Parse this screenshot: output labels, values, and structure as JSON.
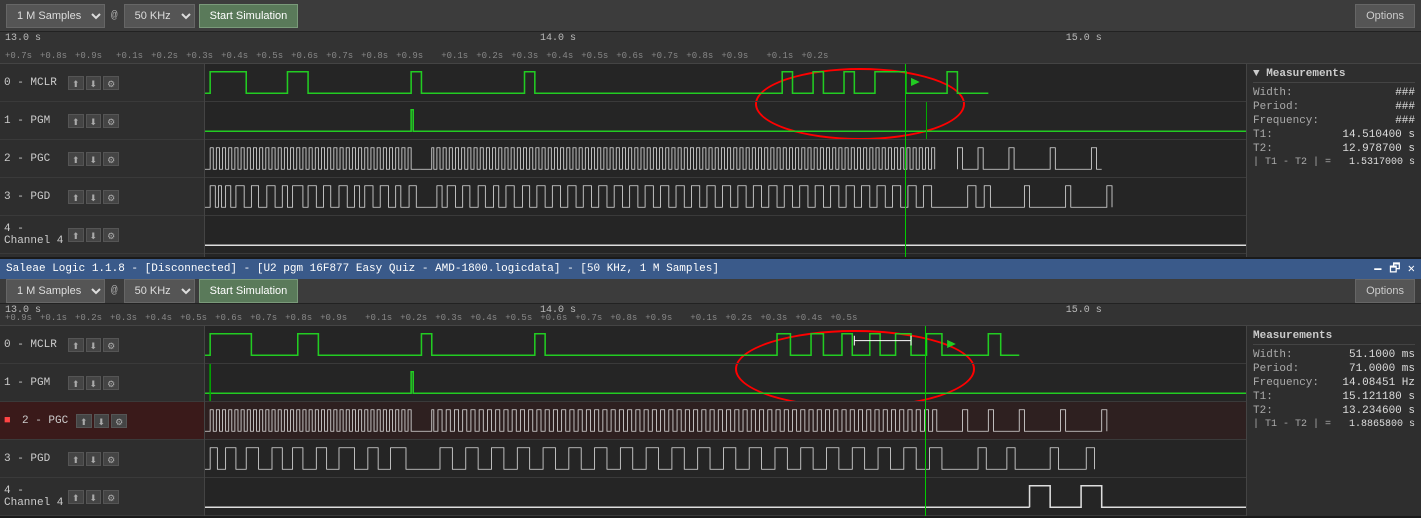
{
  "panel1": {
    "toolbar": {
      "samples_label": "1 M Samples",
      "at_label": "@",
      "freq_label": "50 KHz",
      "start_btn": "Start Simulation",
      "options_btn": "Options"
    },
    "ruler": {
      "major_labels": [
        "13.0 s",
        "14.0 s",
        "15.0 s"
      ],
      "minor_ticks": [
        "+0.7s",
        "+0.8s",
        "+0.9s",
        "+0.1s",
        "+0.2s",
        "+0.3s",
        "+0.4s",
        "+0.5s",
        "+0.6s",
        "+0.7s",
        "+0.8s",
        "+0.9s",
        "+0.1s",
        "+0.2s",
        "+0.3s",
        "+0.4s",
        "+0.5s",
        "+0.6s",
        "+0.7s",
        "+0.8s",
        "+0.9s",
        "+0.1s",
        "+0.2s"
      ]
    },
    "channels": [
      {
        "id": "0",
        "name": "0 - MCLR"
      },
      {
        "id": "1",
        "name": "1 - PGM"
      },
      {
        "id": "2",
        "name": "2 - PGC"
      },
      {
        "id": "3",
        "name": "3 - PGD"
      },
      {
        "id": "4",
        "name": "4 - Channel 4"
      }
    ],
    "measurements": {
      "title": "▼ Measurements",
      "rows": [
        {
          "label": "Width:",
          "value": "###"
        },
        {
          "label": "Period:",
          "value": "###"
        },
        {
          "label": "Frequency:",
          "value": "###"
        },
        {
          "label": "T1:",
          "value": "14.510400 s"
        },
        {
          "label": "T2:",
          "value": "12.978700 s"
        },
        {
          "label": "| T1 - T2 | =",
          "value": "1.5317000 s"
        }
      ]
    }
  },
  "panel2": {
    "title": "Saleae Logic 1.1.8 - [Disconnected] - [U2 pgm 16F877 Easy Quiz - AMD-1800.logicdata] - [50 KHz, 1 M Samples]",
    "toolbar": {
      "samples_label": "1 M Samples",
      "at_label": "@",
      "freq_label": "50 KHz",
      "start_btn": "Start Simulation",
      "options_btn": "Options"
    },
    "ruler": {
      "major_labels": [
        "13.0 s",
        "14.0 s",
        "15.0 s"
      ],
      "minor_ticks": [
        "+0.9s",
        "+0.1s",
        "+0.2s",
        "+0.3s",
        "+0.4s",
        "+0.5s",
        "+0.6s",
        "+0.7s",
        "+0.8s",
        "+0.9s",
        "+0.1s",
        "+0.2s",
        "+0.3s",
        "+0.4s",
        "+0.5s",
        "+0.6s",
        "+0.7s",
        "+0.8s",
        "+0.9s",
        "+0.1s",
        "+0.2s",
        "+0.3s",
        "+0.4s",
        "+0.5s"
      ]
    },
    "channels": [
      {
        "id": "0",
        "name": "0 - MCLR"
      },
      {
        "id": "1",
        "name": "1 - PGM"
      },
      {
        "id": "2",
        "name": "2 - PGC",
        "highlighted": true
      },
      {
        "id": "3",
        "name": "3 - PGD"
      },
      {
        "id": "4",
        "name": "4 - Channel 4"
      }
    ],
    "measurements": {
      "title": "Measurements",
      "rows": [
        {
          "label": "Width:",
          "value": "51.1000 ms"
        },
        {
          "label": "Period:",
          "value": "71.0000 ms"
        },
        {
          "label": "Frequency:",
          "value": "14.08451 Hz"
        },
        {
          "label": "T1:",
          "value": "15.121180 s"
        },
        {
          "label": "T2:",
          "value": "13.234600 s"
        },
        {
          "label": "| T1 - T2 | =",
          "value": "1.8865800 s"
        }
      ]
    }
  }
}
